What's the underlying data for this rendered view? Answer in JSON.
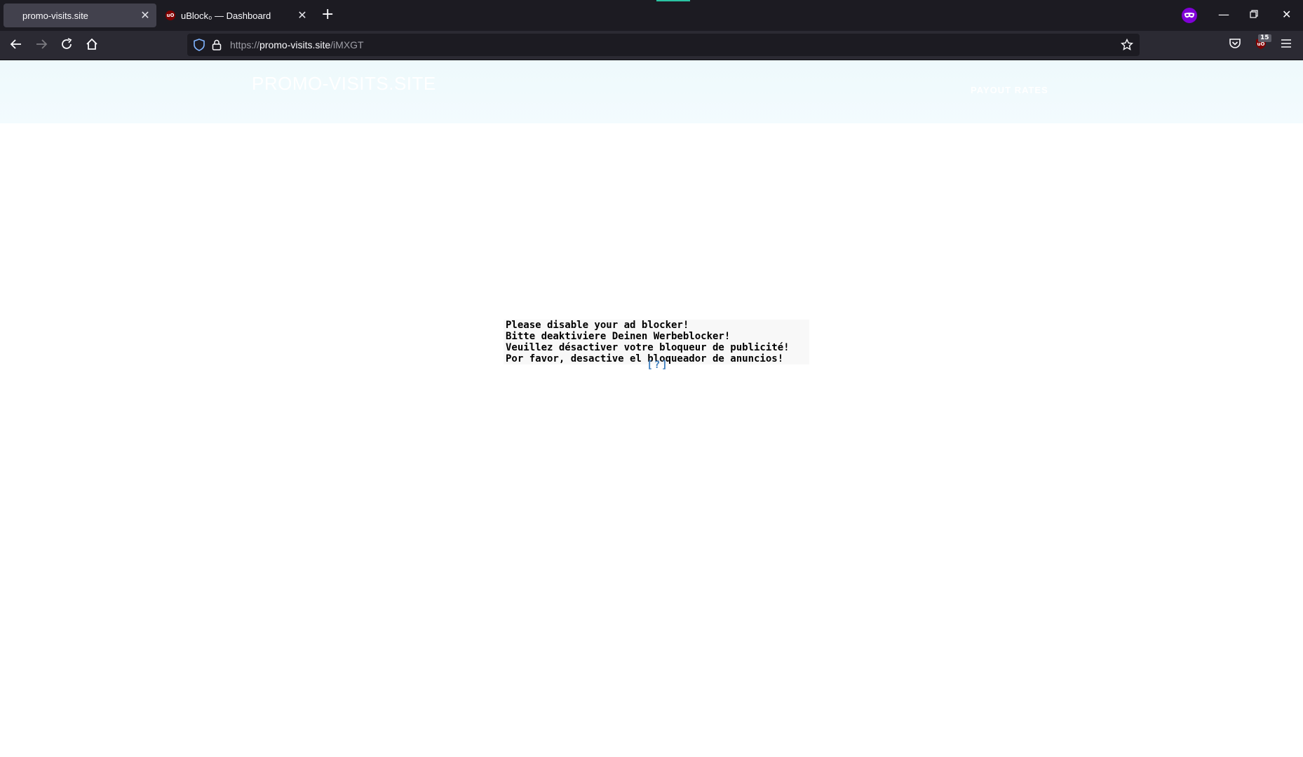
{
  "browser": {
    "tabs": [
      {
        "title": "promo-visits.site",
        "active": true
      },
      {
        "title": "uBlock₀ — Dashboard",
        "active": false,
        "favicon": "ublock-icon"
      }
    ],
    "address_bar": {
      "scheme": "https://",
      "host": "promo-visits.site",
      "path": "/iMXGT"
    },
    "ublock_badge_count": "15",
    "accent_color": "#2ac3a2",
    "private_icon_color": "#8000d7"
  },
  "site": {
    "title": "PROMO-VISITS.SITE",
    "nav_link": "PAYOUT RATES"
  },
  "adblock_notice": {
    "lines": [
      "Please disable your ad blocker!",
      "Bitte deaktiviere Deinen Werbeblocker!",
      "Veuillez désactiver votre bloqueur de publicité!",
      "Por favor, desactive el bloqueador de anuncios!"
    ],
    "help_link": "[?]"
  }
}
